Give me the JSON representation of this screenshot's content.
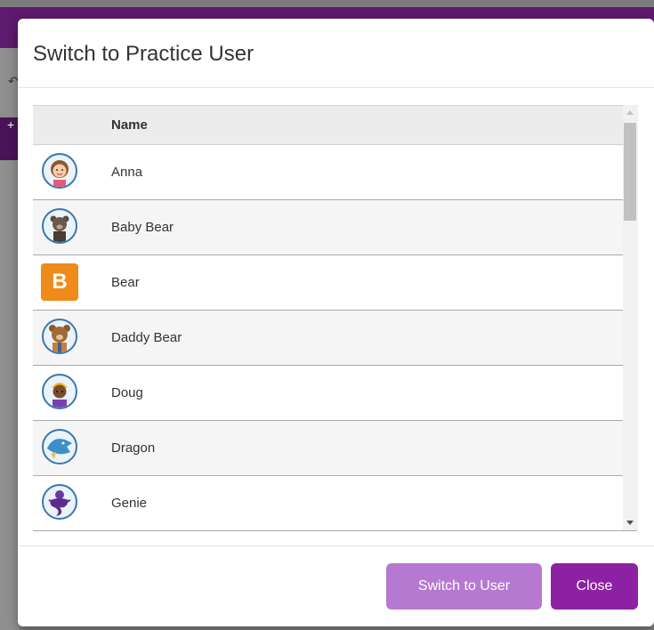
{
  "dialog": {
    "title": "Switch to Practice User",
    "table_header": {
      "name": "Name"
    },
    "users": [
      {
        "name": "Anna",
        "avatar": "girl-avatar-icon"
      },
      {
        "name": "Baby Bear",
        "avatar": "baby-bear-avatar-icon"
      },
      {
        "name": "Bear",
        "avatar": "letter-b-avatar",
        "letter": "B"
      },
      {
        "name": "Daddy Bear",
        "avatar": "daddy-bear-avatar-icon"
      },
      {
        "name": "Doug",
        "avatar": "boy-avatar-icon"
      },
      {
        "name": "Dragon",
        "avatar": "dragon-avatar-icon"
      },
      {
        "name": "Genie",
        "avatar": "genie-avatar-icon"
      }
    ],
    "buttons": {
      "switch": "Switch to User",
      "close": "Close"
    }
  },
  "colors": {
    "accent": "#8c22a3",
    "accent_disabled": "#b679d1",
    "letter_avatar": "#ef8b1b"
  }
}
